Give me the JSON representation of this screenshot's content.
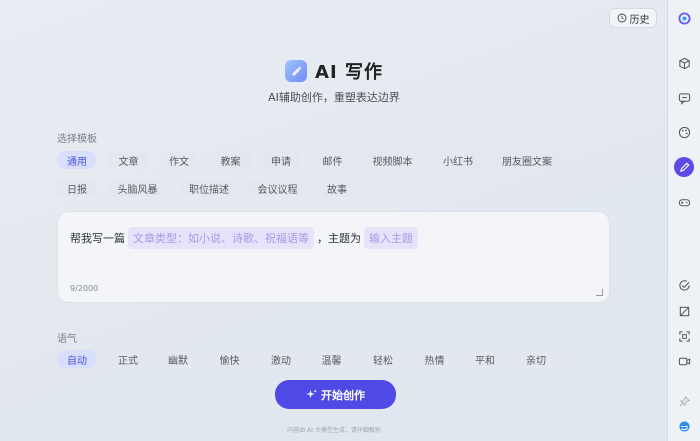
{
  "header": {
    "history_label": "历史",
    "title": "AI 写作",
    "subtitle": "AI辅助创作，重塑表达边界"
  },
  "template": {
    "label": "选择模板",
    "chips": [
      "通用",
      "文章",
      "作文",
      "教案",
      "申请",
      "邮件",
      "视频脚本",
      "小红书",
      "朋友圈文案",
      "日报",
      "头脑风暴",
      "职位描述",
      "会议议程",
      "故事"
    ],
    "selected": "通用"
  },
  "prompt": {
    "prefix": "帮我写一篇",
    "slot1_placeholder": "文章类型：如小说、诗歌、祝福语等",
    "middle": "，主题为",
    "slot2_placeholder": "输入主题",
    "counter": "9/2000"
  },
  "tone": {
    "label": "语气",
    "chips": [
      "自动",
      "正式",
      "幽默",
      "愉快",
      "激动",
      "温馨",
      "轻松",
      "热情",
      "平和",
      "亲切"
    ],
    "selected": "自动"
  },
  "actions": {
    "start_label": "开始创作",
    "start_icon": "sparkle-icon"
  },
  "footer": {
    "text": "内容由 AI 大模型生成，请仔细甄别"
  },
  "rail": {
    "icons": [
      "app-logo-icon",
      "cube-add-icon",
      "chat-icon",
      "palette-icon",
      "pen-icon",
      "gamepad-icon",
      "check-circle-icon",
      "crop-icon",
      "scan-icon",
      "video-icon",
      "pin-icon",
      "browser-logo-icon"
    ],
    "active": "pen-icon"
  },
  "colors": {
    "accent": "#4f49e6",
    "chip_active_bg": "#d9defc",
    "chip_active_text": "#4b55d8",
    "slot_bg": "#e6e3fb",
    "slot_text": "#a79ae6"
  }
}
